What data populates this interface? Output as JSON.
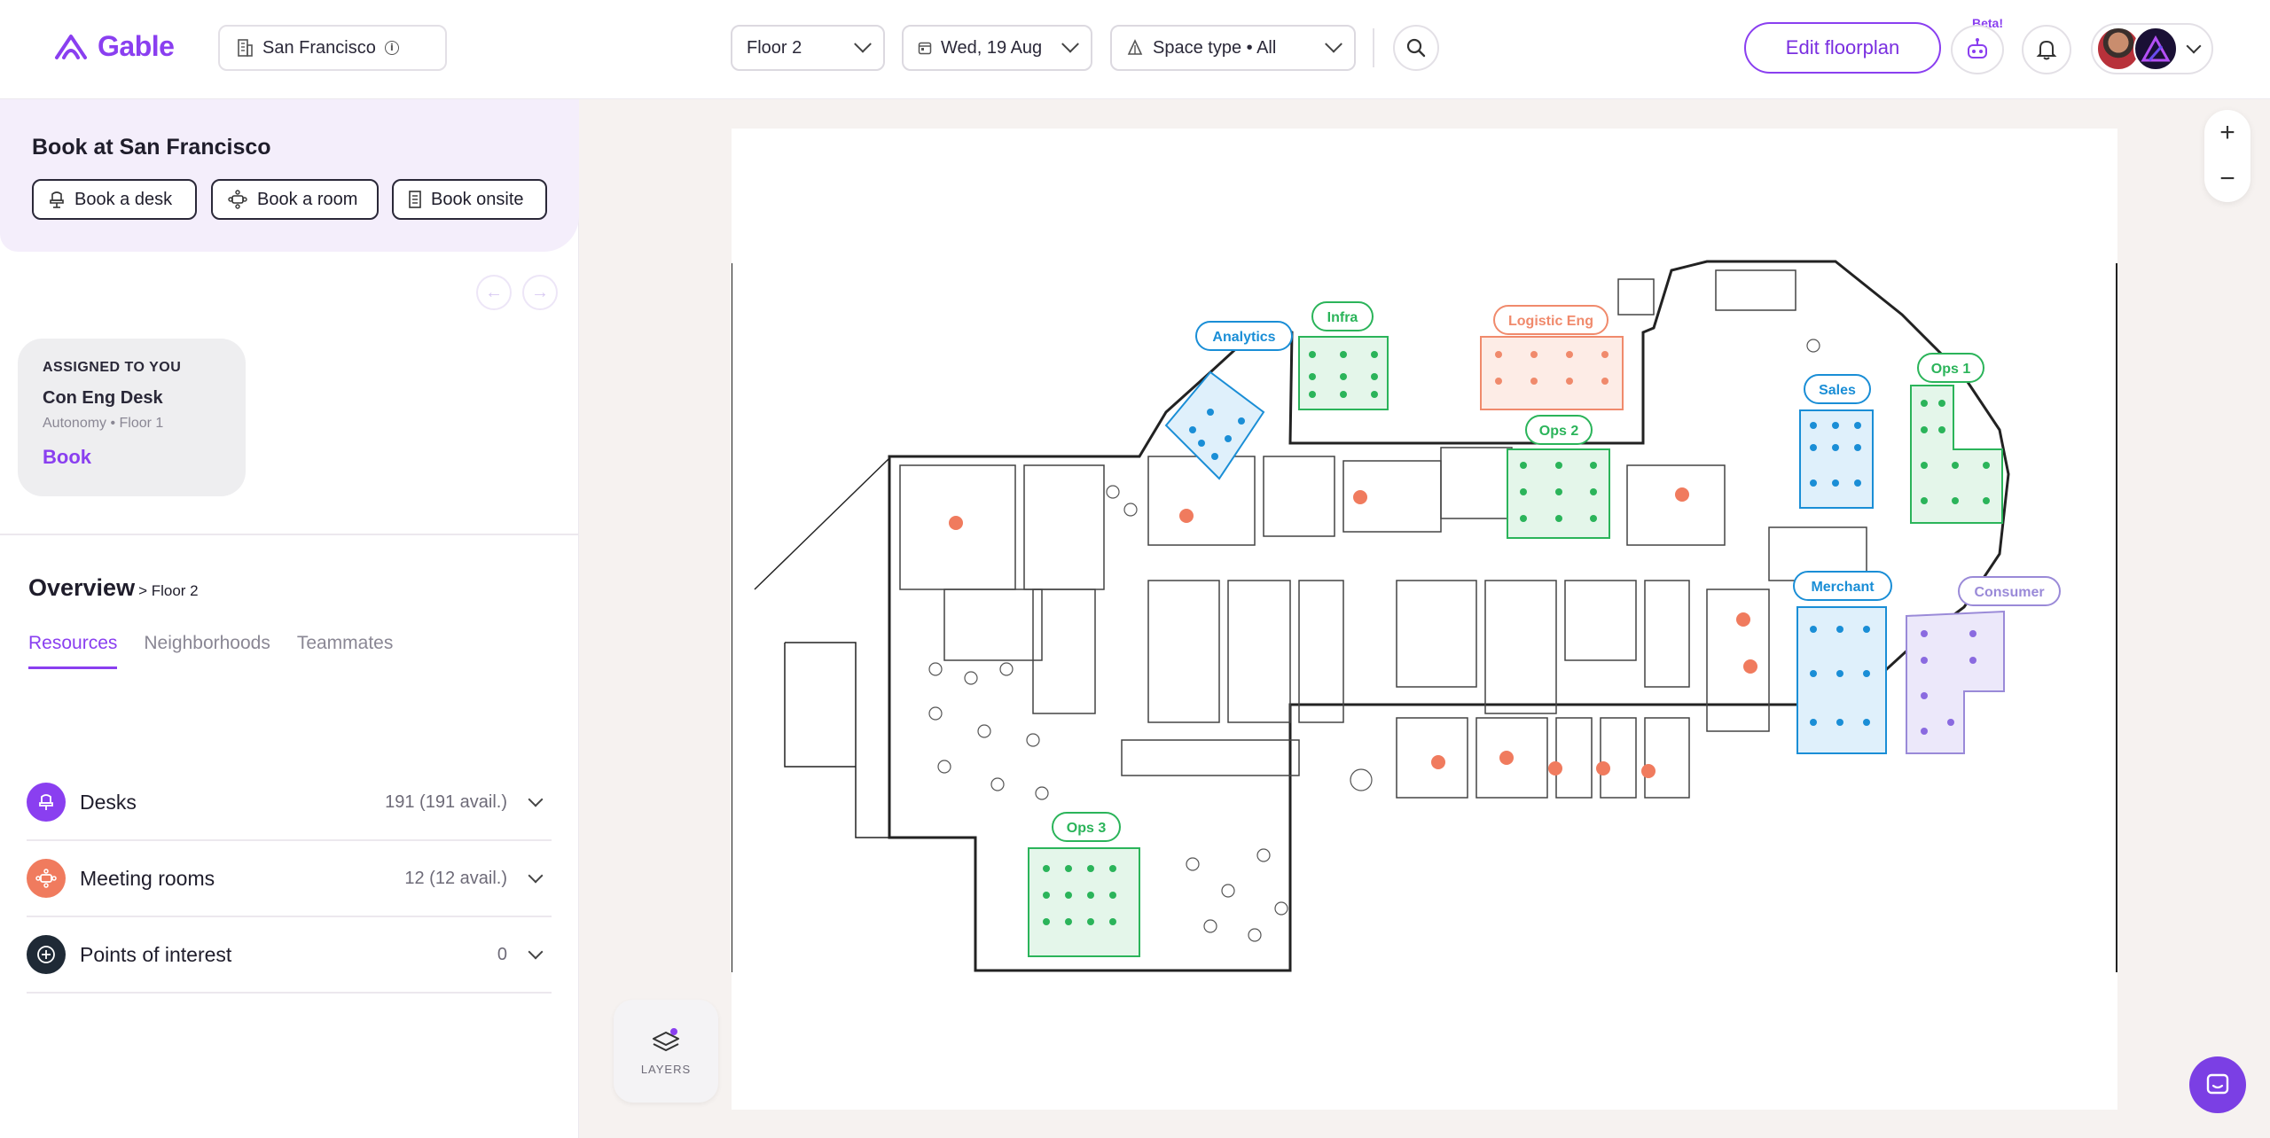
{
  "header": {
    "brand": "Gable",
    "location": "San Francisco",
    "floor": "Floor 2",
    "date": "Wed, 19 Aug",
    "space_type": "Space type • All",
    "edit_label": "Edit floorplan",
    "beta_label": "Beta!"
  },
  "book": {
    "title": "Book at San Francisco",
    "desk": "Book a desk",
    "room": "Book a room",
    "onsite": "Book onsite"
  },
  "assigned": {
    "label": "ASSIGNED TO YOU",
    "name": "Con Eng Desk",
    "sub": "Autonomy • Floor 1",
    "action": "Book"
  },
  "overview": {
    "title": "Overview",
    "crumb": "> Floor 2",
    "tabs": [
      "Resources",
      "Neighborhoods",
      "Teammates"
    ],
    "resources": [
      {
        "name": "Desks",
        "count": "191 (191 avail.)"
      },
      {
        "name": "Meeting rooms",
        "count": "12 (12 avail.)"
      },
      {
        "name": "Points of interest",
        "count": "0"
      }
    ]
  },
  "map": {
    "labels": {
      "analytics": "Analytics",
      "infra": "Infra",
      "logistic": "Logistic Eng",
      "ops2": "Ops 2",
      "sales": "Sales",
      "ops1": "Ops 1",
      "merchant": "Merchant",
      "consumer": "Consumer",
      "ops3": "Ops 3"
    },
    "colors": {
      "blue": "#1a8ed6",
      "green": "#2bb45a",
      "salmon": "#f08a6c",
      "lavender": "#9a8ad8"
    }
  },
  "layers_label": "LAYERS",
  "colors": {
    "accent": "#8a3ff0",
    "desk_icon_bg": "#8a3ff0",
    "room_icon_bg": "#f07b5e",
    "poi_icon_bg": "#1f2a36"
  }
}
